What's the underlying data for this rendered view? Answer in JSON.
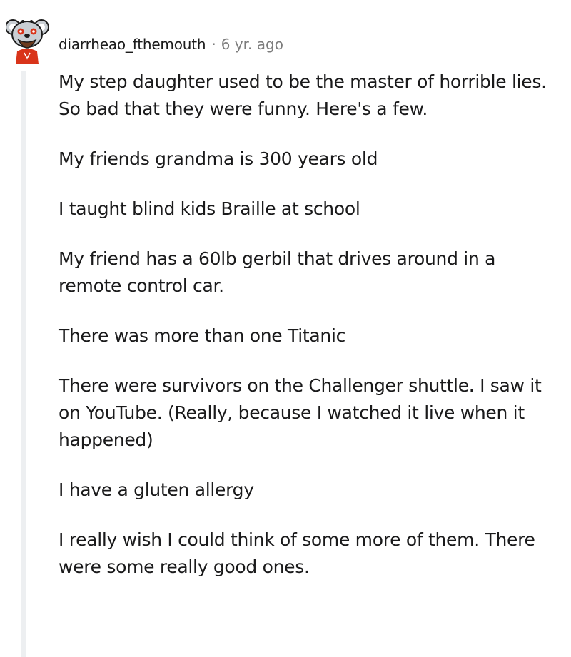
{
  "comment": {
    "username": "diarrheao_fthemouth",
    "separator": "·",
    "age": "6 yr. ago",
    "avatar_icon": "snoo-avatar-icon",
    "paragraphs": [
      "My step daughter used to be the master of horrible lies. So bad that they were funny. Here's a few.",
      "My friends grandma is 300 years old",
      "I taught blind kids Braille at school",
      "My friend has a 60lb gerbil that drives around in a remote control car.",
      "There was more than one Titanic",
      "There were survivors on the Challenger shuttle. I saw it on YouTube. (Really, because I watched it live when it happened)",
      "I have a gluten allergy",
      "I really wish I could think of some more of them. There were some really good ones."
    ]
  },
  "colors": {
    "text": "#1a1a1b",
    "meta": "#7c7c7c",
    "thread_line": "#edeff1",
    "avatar_red": "#d9341a",
    "avatar_brown": "#6b3a1e"
  }
}
